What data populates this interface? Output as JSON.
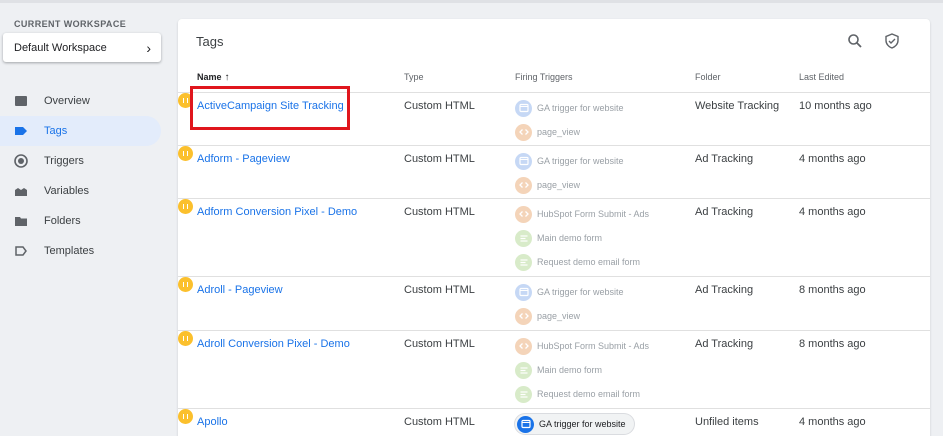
{
  "sidebar": {
    "workspace_label": "CURRENT WORKSPACE",
    "workspace_name": "Default Workspace",
    "items": [
      {
        "label": "Overview",
        "icon": "overview-icon"
      },
      {
        "label": "Tags",
        "icon": "tag-icon",
        "active": true
      },
      {
        "label": "Triggers",
        "icon": "trigger-icon"
      },
      {
        "label": "Variables",
        "icon": "variables-icon"
      },
      {
        "label": "Folders",
        "icon": "folder-icon"
      },
      {
        "label": "Templates",
        "icon": "template-icon"
      }
    ]
  },
  "main": {
    "title": "Tags",
    "columns": {
      "name": "Name",
      "type": "Type",
      "triggers": "Firing Triggers",
      "folder": "Folder",
      "edited": "Last Edited"
    },
    "rows": [
      {
        "name": "ActiveCampaign Site Tracking",
        "type": "Custom HTML",
        "folder": "Website Tracking",
        "edited": "10 months ago",
        "triggers": [
          {
            "label": "GA trigger for website",
            "kind": "pageview"
          },
          {
            "label": "page_view",
            "kind": "event"
          }
        ]
      },
      {
        "name": "Adform - Pageview",
        "type": "Custom HTML",
        "folder": "Ad Tracking",
        "edited": "4 months ago",
        "triggers": [
          {
            "label": "GA trigger for website",
            "kind": "pageview"
          },
          {
            "label": "page_view",
            "kind": "event"
          }
        ]
      },
      {
        "name": "Adform Conversion Pixel - Demo",
        "type": "Custom HTML",
        "folder": "Ad Tracking",
        "edited": "4 months ago",
        "triggers": [
          {
            "label": "HubSpot Form Submit - Ads",
            "kind": "event"
          },
          {
            "label": "Main demo form",
            "kind": "form"
          },
          {
            "label": "Request demo email form",
            "kind": "form"
          }
        ]
      },
      {
        "name": "Adroll - Pageview",
        "type": "Custom HTML",
        "folder": "Ad Tracking",
        "edited": "8 months ago",
        "triggers": [
          {
            "label": "GA trigger for website",
            "kind": "pageview"
          },
          {
            "label": "page_view",
            "kind": "event"
          }
        ]
      },
      {
        "name": "Adroll Conversion Pixel - Demo",
        "type": "Custom HTML",
        "folder": "Ad Tracking",
        "edited": "8 months ago",
        "triggers": [
          {
            "label": "HubSpot Form Submit - Ads",
            "kind": "event"
          },
          {
            "label": "Main demo form",
            "kind": "form"
          },
          {
            "label": "Request demo email form",
            "kind": "form"
          }
        ]
      },
      {
        "name": "Apollo",
        "type": "Custom HTML",
        "folder": "Unfiled items",
        "edited": "4 months ago",
        "triggers": [
          {
            "label": "GA trigger for website",
            "kind": "pageview",
            "highlighted": true
          }
        ]
      }
    ]
  },
  "colors": {
    "accent": "#1a73e8",
    "status": "#fbc02d",
    "highlight": "#e0161d"
  }
}
